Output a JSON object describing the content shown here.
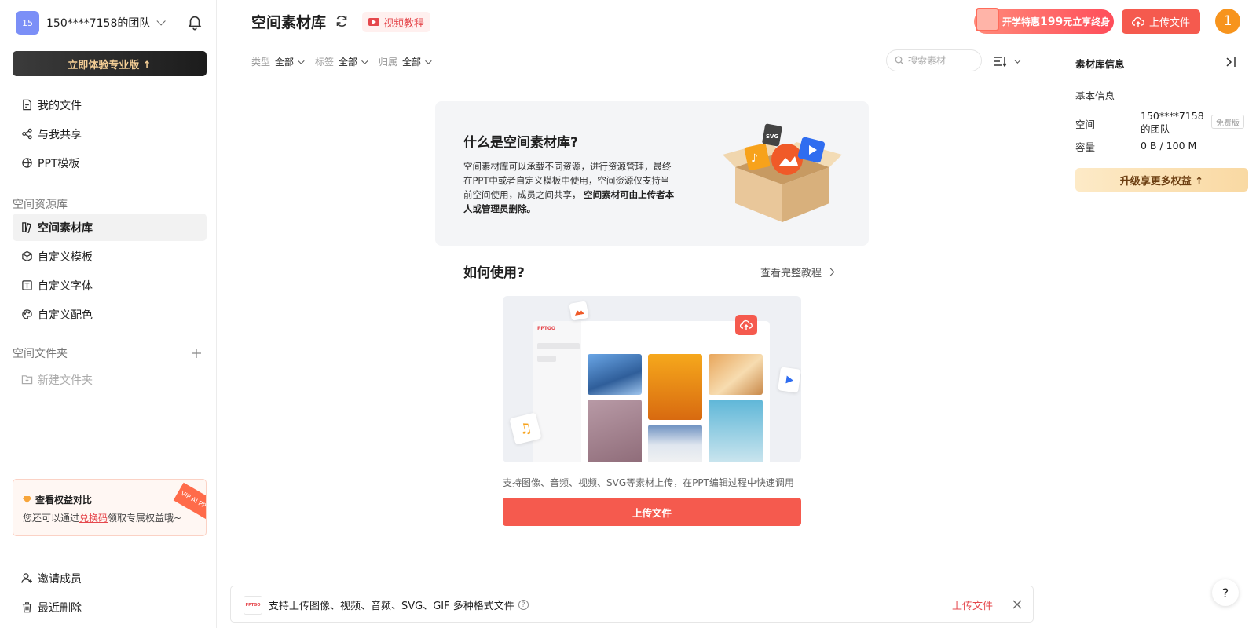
{
  "sidebar": {
    "team_avatar": "15",
    "team_name": "150****7158的团队",
    "pro_button": "立即体验专业版 ↑",
    "nav": [
      {
        "label": "我的文件",
        "icon": "file-icon"
      },
      {
        "label": "与我共享",
        "icon": "share-icon"
      },
      {
        "label": "PPT模板",
        "icon": "template-icon"
      }
    ],
    "space_section_label": "空间资源库",
    "space_nav": [
      {
        "label": "空间素材库",
        "icon": "material-library-icon",
        "active": true
      },
      {
        "label": "自定义模板",
        "icon": "cube-icon"
      },
      {
        "label": "自定义字体",
        "icon": "font-icon"
      },
      {
        "label": "自定义配色",
        "icon": "palette-icon"
      }
    ],
    "folder_section_label": "空间文件夹",
    "new_folder": "新建文件夹",
    "promo": {
      "title": "查看权益对比",
      "text_before": "您还可以通过",
      "link": "兑换码",
      "text_after": "领取专属权益哦~",
      "vip_tag": "VIP AI PPT"
    },
    "bottom_nav": [
      {
        "label": "邀请成员",
        "icon": "add-user-icon"
      },
      {
        "label": "最近删除",
        "icon": "trash-icon"
      }
    ]
  },
  "header": {
    "title": "空间素材库",
    "video_tutorial": "视频教程",
    "promo_banner_prefix": "开学特惠",
    "promo_banner_price": "199",
    "promo_banner_suffix": "元立享终身",
    "upload_button": "上传文件",
    "user_avatar": "1"
  },
  "filters": [
    {
      "label": "类型",
      "value": "全部"
    },
    {
      "label": "标签",
      "value": "全部"
    },
    {
      "label": "归属",
      "value": "全部"
    }
  ],
  "search": {
    "placeholder": "搜索素材"
  },
  "intro": {
    "title": "什么是空间素材库?",
    "text": "空间素材库可以承载不同资源，进行资源管理，最终在PPT中或者自定义模板中使用，空间资源仅支持当前空间使用，成员之间共享，",
    "text_bold": "空间素材可由上传者本人或管理员删除。"
  },
  "howto": {
    "title": "如何使用?",
    "link": "查看完整教程",
    "caption": "支持图像、音频、视频、SVG等素材上传，在PPT编辑过程中快速调用",
    "upload_button": "上传文件",
    "demo_logo": "PPTGO"
  },
  "notice": {
    "logo": "PPTGO",
    "text": "支持上传图像、视频、音频、SVG、GIF 多种格式文件",
    "upload": "上传文件"
  },
  "right_panel": {
    "title": "素材库信息",
    "section": "基本信息",
    "space_key": "空间",
    "space_value": "150****7158的团队",
    "space_badge": "免费版",
    "capacity_key": "容量",
    "capacity_value": "0 B / 100 M",
    "upgrade_button": "升级享更多权益 ↑"
  },
  "help": "?",
  "colors": {
    "accent": "#f55a4e",
    "link_red": "#e5484d",
    "pro_gold": "#f5cf96",
    "avatar_orange": "#f7941d"
  }
}
